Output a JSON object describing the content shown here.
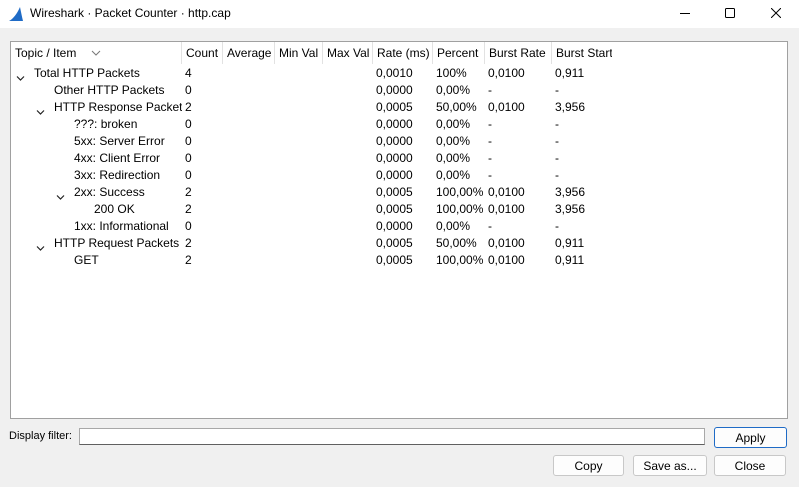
{
  "window": {
    "title": "Wireshark · Packet Counter · http.cap",
    "app_icon": "wireshark-fin-icon",
    "accent_color": "#1f6bc6"
  },
  "table": {
    "columns": [
      "Topic / Item",
      "Count",
      "Average",
      "Min Val",
      "Max Val",
      "Rate (ms)",
      "Percent",
      "Burst Rate",
      "Burst Start"
    ],
    "rows": [
      {
        "topic": "Total HTTP Packets",
        "level": 0,
        "expanded": true,
        "count": "4",
        "average": "",
        "min": "",
        "max": "",
        "rate": "0,0010",
        "percent": "100%",
        "burst_rate": "0,0100",
        "burst_start": "0,911"
      },
      {
        "topic": "Other HTTP Packets",
        "level": 1,
        "expanded": null,
        "count": "0",
        "average": "",
        "min": "",
        "max": "",
        "rate": "0,0000",
        "percent": "0,00%",
        "burst_rate": "-",
        "burst_start": "-"
      },
      {
        "topic": "HTTP Response Packets",
        "level": 1,
        "expanded": true,
        "count": "2",
        "average": "",
        "min": "",
        "max": "",
        "rate": "0,0005",
        "percent": "50,00%",
        "burst_rate": "0,0100",
        "burst_start": "3,956"
      },
      {
        "topic": "???: broken",
        "level": 2,
        "expanded": null,
        "count": "0",
        "average": "",
        "min": "",
        "max": "",
        "rate": "0,0000",
        "percent": "0,00%",
        "burst_rate": "-",
        "burst_start": "-"
      },
      {
        "topic": "5xx: Server Error",
        "level": 2,
        "expanded": null,
        "count": "0",
        "average": "",
        "min": "",
        "max": "",
        "rate": "0,0000",
        "percent": "0,00%",
        "burst_rate": "-",
        "burst_start": "-"
      },
      {
        "topic": "4xx: Client Error",
        "level": 2,
        "expanded": null,
        "count": "0",
        "average": "",
        "min": "",
        "max": "",
        "rate": "0,0000",
        "percent": "0,00%",
        "burst_rate": "-",
        "burst_start": "-"
      },
      {
        "topic": "3xx: Redirection",
        "level": 2,
        "expanded": null,
        "count": "0",
        "average": "",
        "min": "",
        "max": "",
        "rate": "0,0000",
        "percent": "0,00%",
        "burst_rate": "-",
        "burst_start": "-"
      },
      {
        "topic": "2xx: Success",
        "level": 2,
        "expanded": true,
        "count": "2",
        "average": "",
        "min": "",
        "max": "",
        "rate": "0,0005",
        "percent": "100,00%",
        "burst_rate": "0,0100",
        "burst_start": "3,956"
      },
      {
        "topic": "200 OK",
        "level": 3,
        "expanded": null,
        "count": "2",
        "average": "",
        "min": "",
        "max": "",
        "rate": "0,0005",
        "percent": "100,00%",
        "burst_rate": "0,0100",
        "burst_start": "3,956"
      },
      {
        "topic": "1xx: Informational",
        "level": 2,
        "expanded": null,
        "count": "0",
        "average": "",
        "min": "",
        "max": "",
        "rate": "0,0000",
        "percent": "0,00%",
        "burst_rate": "-",
        "burst_start": "-"
      },
      {
        "topic": "HTTP Request Packets",
        "level": 1,
        "expanded": true,
        "count": "2",
        "average": "",
        "min": "",
        "max": "",
        "rate": "0,0005",
        "percent": "50,00%",
        "burst_rate": "0,0100",
        "burst_start": "0,911"
      },
      {
        "topic": "GET",
        "level": 2,
        "expanded": null,
        "count": "2",
        "average": "",
        "min": "",
        "max": "",
        "rate": "0,0005",
        "percent": "100,00%",
        "burst_rate": "0,0100",
        "burst_start": "0,911"
      }
    ]
  },
  "filter": {
    "label": "Display filter:",
    "value": "",
    "placeholder": ""
  },
  "buttons": {
    "apply": "Apply",
    "copy": "Copy",
    "save_as": "Save as...",
    "close": "Close"
  }
}
